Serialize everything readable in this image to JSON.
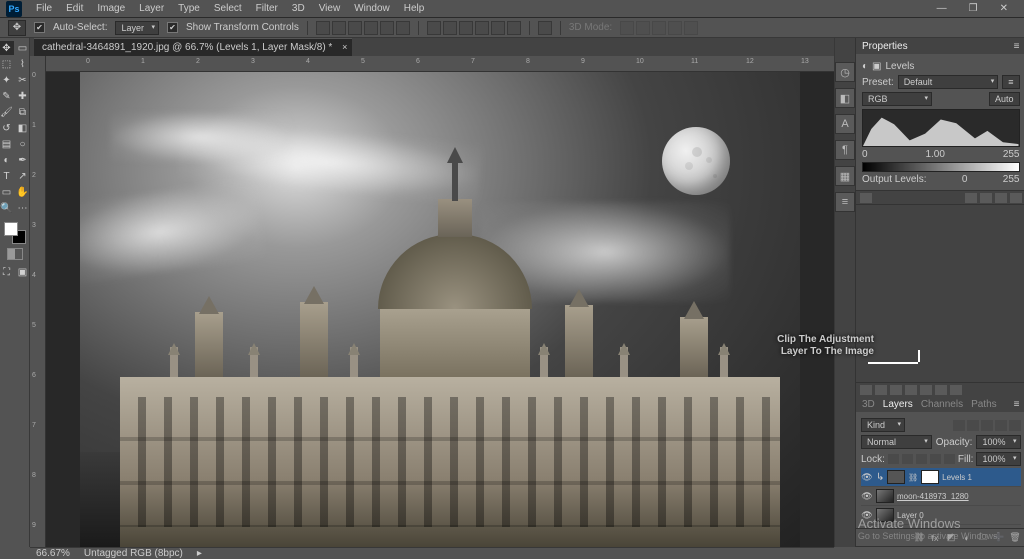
{
  "menubar": {
    "items": [
      "File",
      "Edit",
      "Image",
      "Layer",
      "Type",
      "Select",
      "Filter",
      "3D",
      "View",
      "Window",
      "Help"
    ]
  },
  "optionsbar": {
    "auto_select_label": "Auto-Select:",
    "auto_select_value": "Layer",
    "transform_label": "Show Transform Controls",
    "mode_label": "3D Mode:"
  },
  "document": {
    "tab_title": "cathedral-3464891_1920.jpg @ 66.7% (Levels 1, Layer Mask/8) *",
    "zoom": "66.67%",
    "info": "Untagged RGB (8bpc)"
  },
  "ruler": {
    "h": [
      "0",
      "1",
      "2",
      "3",
      "4",
      "5",
      "6",
      "7",
      "8",
      "9",
      "10",
      "11",
      "12",
      "13"
    ],
    "v": [
      "0",
      "1",
      "2",
      "3",
      "4",
      "5",
      "6",
      "7",
      "8",
      "9"
    ]
  },
  "properties": {
    "title": "Properties",
    "adj_label": "Levels",
    "preset_label": "Preset:",
    "preset_value": "Default",
    "channel_value": "RGB",
    "auto_label": "Auto",
    "in_black": "0",
    "in_mid": "1.00",
    "in_white": "255",
    "output_label": "Output Levels:",
    "out_black": "0",
    "out_white": "255"
  },
  "layers_panel": {
    "tabs": [
      "3D",
      "Layers",
      "Channels",
      "Paths"
    ],
    "kind_label": "Kind",
    "blend_mode": "Normal",
    "opacity_label": "Opacity:",
    "opacity_value": "100%",
    "lock_label": "Lock:",
    "fill_label": "Fill:",
    "fill_value": "100%",
    "layers": [
      {
        "name": "Levels 1",
        "type": "adjustment"
      },
      {
        "name": "moon-418973_1280",
        "type": "smart"
      },
      {
        "name": "Layer 0",
        "type": "image"
      }
    ]
  },
  "annotation": {
    "line1": "Clip The Adjustment",
    "line2": "Layer To The Image"
  },
  "watermark": {
    "title": "Activate Windows",
    "subtitle": "Go to Settings to activate Windows."
  }
}
